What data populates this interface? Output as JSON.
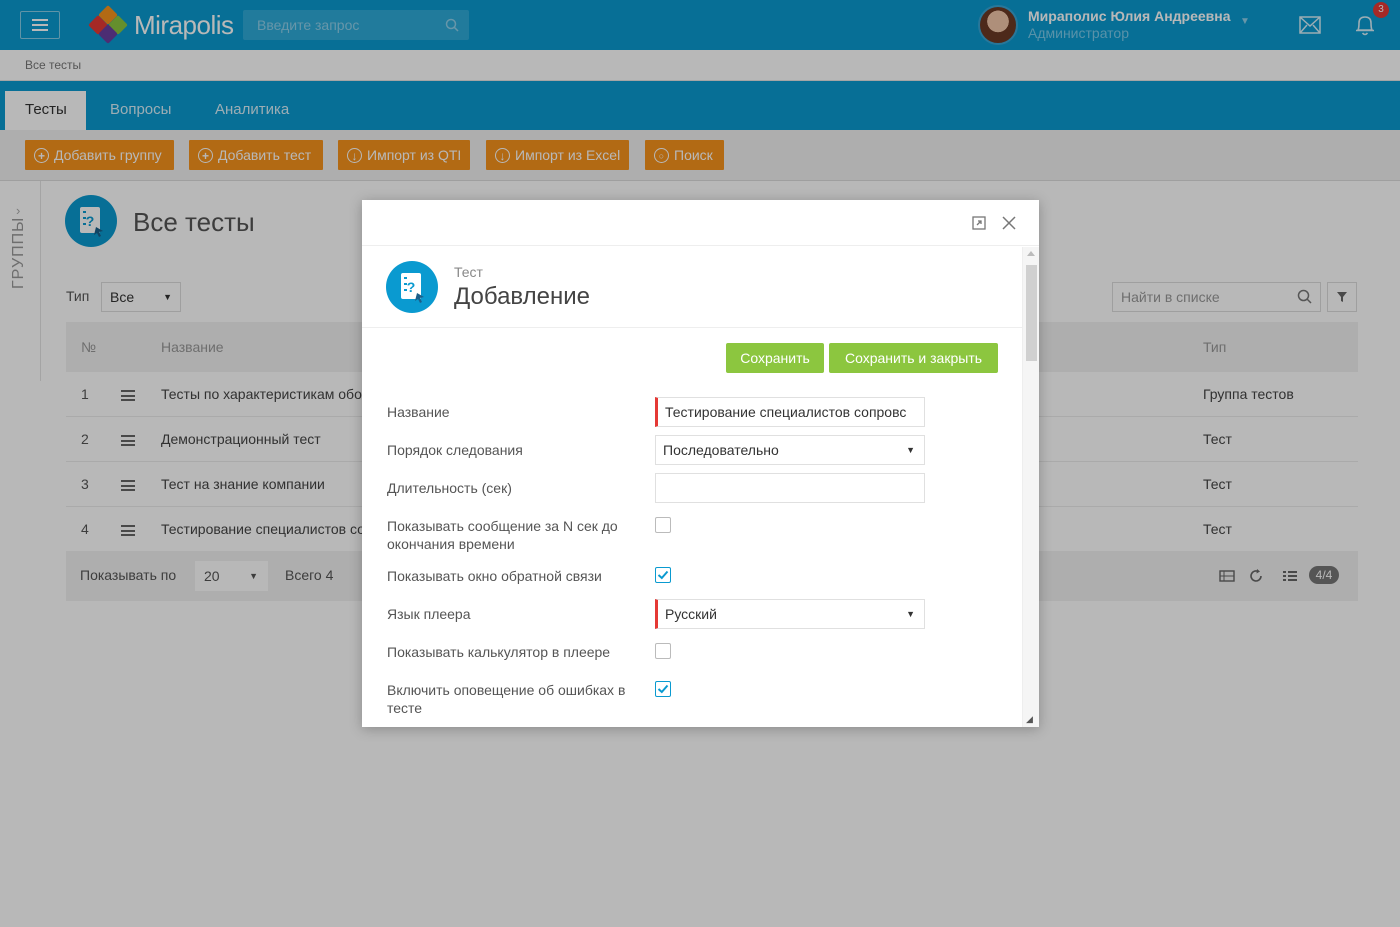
{
  "header": {
    "menu_icon": "hamburger-icon",
    "logo_text": "Mirapolis",
    "search_placeholder": "Введите запрос",
    "user_name": "Мираполис Юлия Андреевна",
    "user_role": "Администратор",
    "notifications_count": "3"
  },
  "breadcrumb": "Все тесты",
  "tabs": [
    {
      "label": "Тесты",
      "active": true
    },
    {
      "label": "Вопросы",
      "active": false
    },
    {
      "label": "Аналитика",
      "active": false
    }
  ],
  "toolbar": {
    "add_group": "Добавить группу",
    "add_test": "Добавить тест",
    "import_qti": "Импорт из QTI",
    "import_excel": "Импорт из Excel",
    "search": "Поиск"
  },
  "groups_label": "ГРУППЫ",
  "page": {
    "title": "Все тесты",
    "type_label": "Тип",
    "type_value": "Все",
    "find_placeholder": "Найти в списке"
  },
  "table": {
    "columns": {
      "num": "№",
      "name": "Название",
      "type": "Тип"
    },
    "rows": [
      {
        "num": "1",
        "name": "Тесты по характеристикам обо",
        "type": "Группа тестов"
      },
      {
        "num": "2",
        "name": "Демонстрационный тест",
        "type": "Тест"
      },
      {
        "num": "3",
        "name": "Тест на знание компании",
        "type": "Тест"
      },
      {
        "num": "4",
        "name": "Тестирование специалистов со",
        "type": "Тест"
      }
    ],
    "footer": {
      "show_label": "Показывать по",
      "page_size": "20",
      "total": "Всего 4",
      "pages": "4/4"
    }
  },
  "modal": {
    "subtitle": "Тест",
    "title": "Добавление",
    "save": "Сохранить",
    "save_close": "Сохранить и закрыть",
    "fields": {
      "name_label": "Название",
      "name_value": "Тестирование специалистов сопровс",
      "order_label": "Порядок следования",
      "order_value": "Последовательно",
      "duration_label": "Длительность (сек)",
      "duration_value": "",
      "warn_label": "Показывать сообщение за N сек до окончания времени",
      "warn_checked": false,
      "feedback_label": "Показывать окно обратной связи",
      "feedback_checked": true,
      "lang_label": "Язык плеера",
      "lang_value": "Русский",
      "calc_label": "Показывать калькулятор в плеере",
      "calc_checked": false,
      "errors_label": "Включить оповещение об ошибках в тесте",
      "errors_checked": true
    }
  },
  "colors": {
    "brand_blue": "#0a9ad0",
    "orange": "#f7941d",
    "green": "#8cc63f",
    "required": "#e53935"
  }
}
